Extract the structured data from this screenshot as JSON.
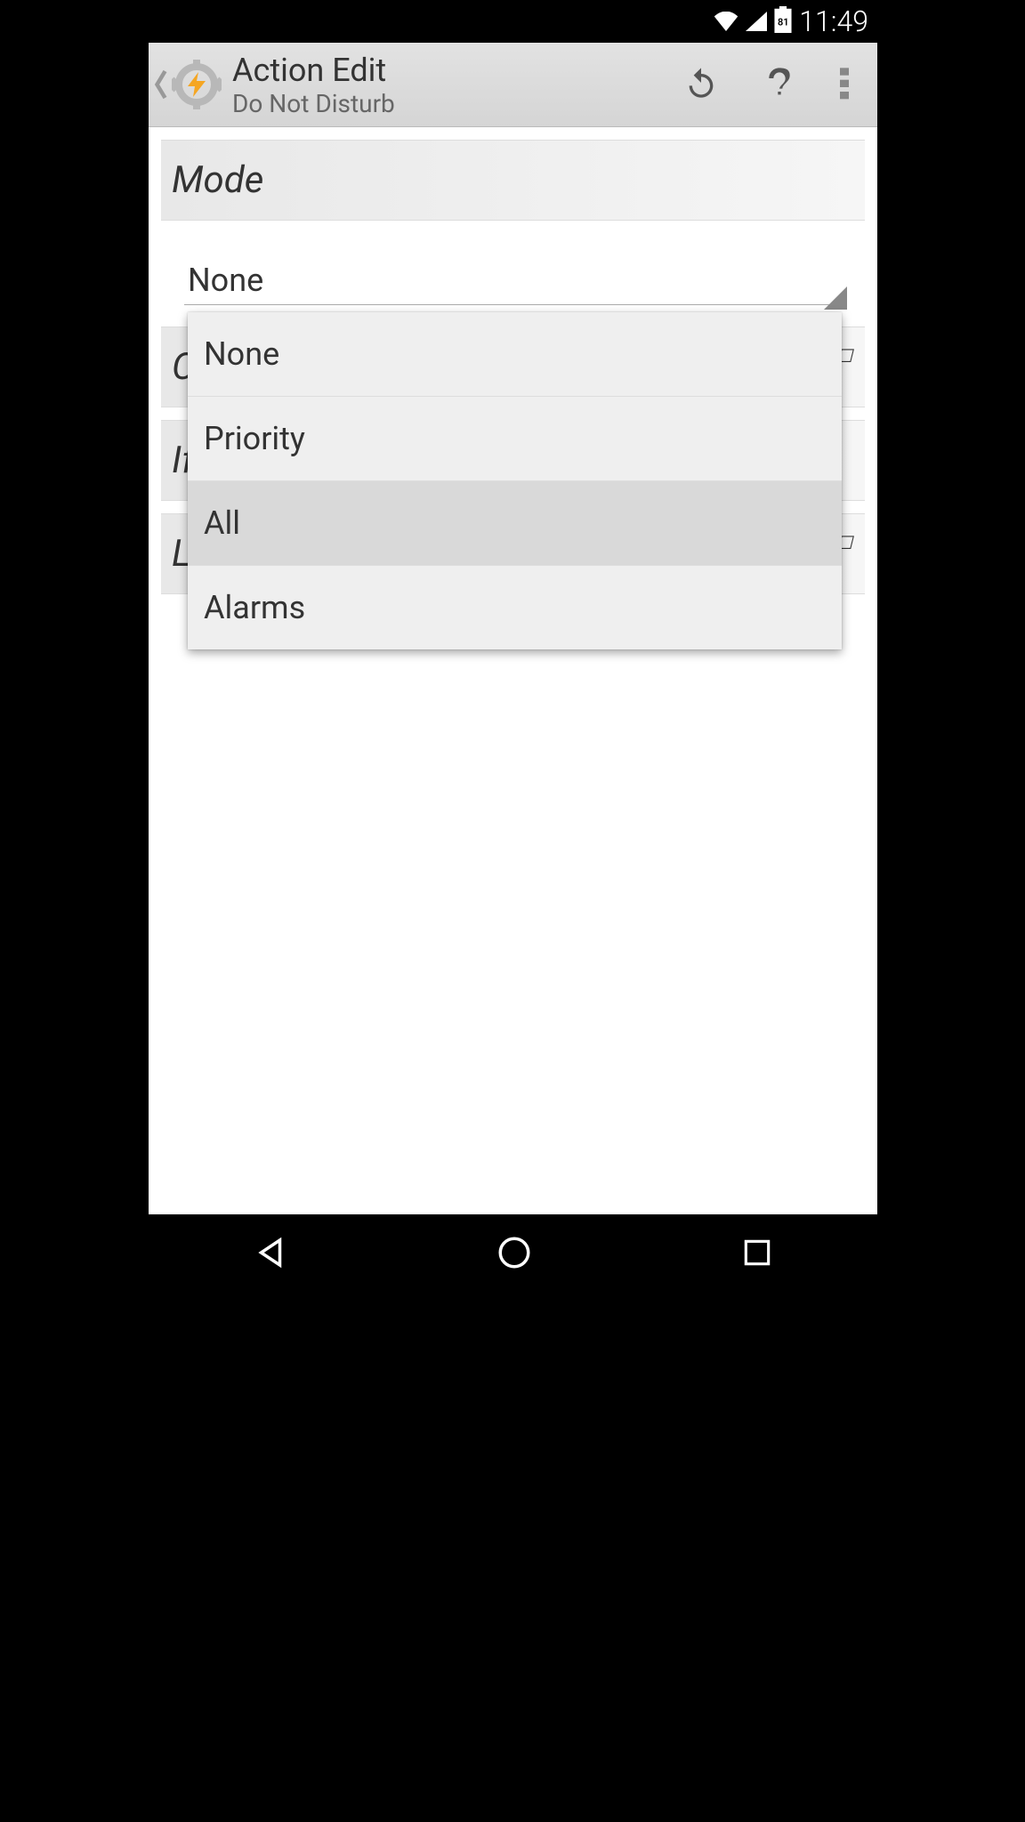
{
  "status": {
    "time": "11:49",
    "battery": "81"
  },
  "appbar": {
    "title": "Action Edit",
    "subtitle": "Do Not Disturb"
  },
  "section": {
    "label": "Mode"
  },
  "spinner": {
    "selected": "None",
    "options": [
      "None",
      "Priority",
      "All",
      "Alarms"
    ]
  },
  "hidden_rows": {
    "r1": "C",
    "r2": "If",
    "r3": "L"
  }
}
